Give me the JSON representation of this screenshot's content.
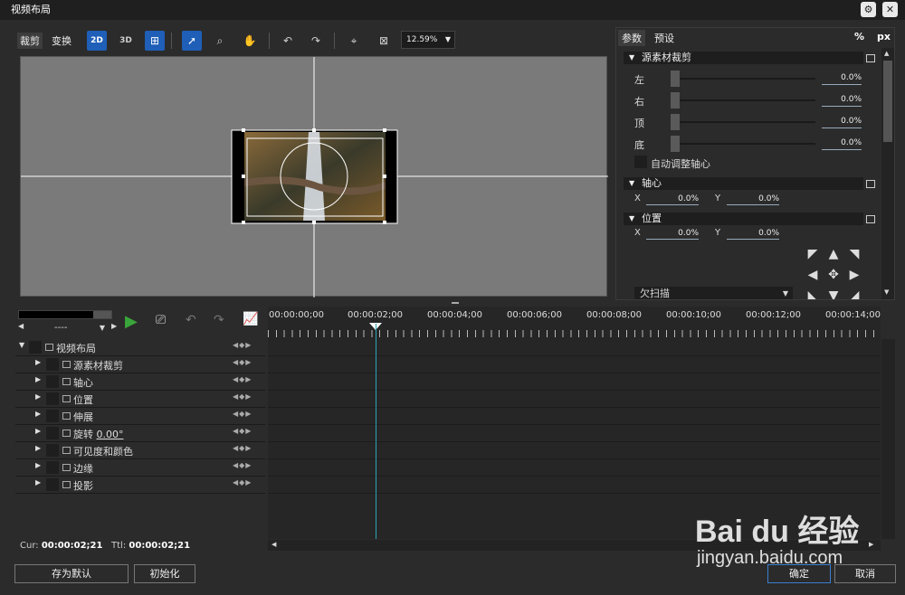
{
  "window": {
    "title": "视频布局"
  },
  "toolbar": {
    "tab_crop": "裁剪",
    "tab_transform": "变换",
    "zoom": "12.59%",
    "btn_2d": "2D",
    "btn_3d": "3D"
  },
  "right_tabs": {
    "params": "参数",
    "presets": "预设",
    "percent": "%",
    "px": "px"
  },
  "source_crop": {
    "title": "源素材裁剪",
    "rows": [
      {
        "label": "左",
        "value": "0.0%"
      },
      {
        "label": "右",
        "value": "0.0%"
      },
      {
        "label": "顶",
        "value": "0.0%"
      },
      {
        "label": "底",
        "value": "0.0%"
      }
    ],
    "auto_anchor": "自动调整轴心"
  },
  "anchor": {
    "title": "轴心",
    "x_label": "X",
    "x_value": "0.0%",
    "y_label": "Y",
    "y_value": "0.0%"
  },
  "position": {
    "title": "位置",
    "x_label": "X",
    "x_value": "0.0%",
    "y_label": "Y",
    "y_value": "0.0%"
  },
  "underscan": "欠扫描",
  "timeline": {
    "timecodes": [
      "00:00:00;00",
      "00:00:02;00",
      "00:00:04;00",
      "00:00:06;00",
      "00:00:08;00",
      "00:00:10;00",
      "00:00:12;00",
      "00:00:14;00"
    ],
    "dropdown": "----"
  },
  "tracks": {
    "root": "视频布局",
    "items": [
      "源素材裁剪",
      "轴心",
      "位置",
      "伸展",
      "旋转",
      "可见度和颜色",
      "边缘",
      "投影"
    ],
    "rotation_value": "0.00°"
  },
  "status": {
    "cur_label": "Cur:",
    "cur_value": "00:00:02;21",
    "ttl_label": "Ttl:",
    "ttl_value": "00:00:02;21"
  },
  "buttons": {
    "save_default": "存为默认",
    "init": "初始化",
    "ok": "确定",
    "cancel": "取消"
  },
  "watermark": {
    "brand": "Bai du 经验",
    "url": "jingyan.baidu.com"
  }
}
